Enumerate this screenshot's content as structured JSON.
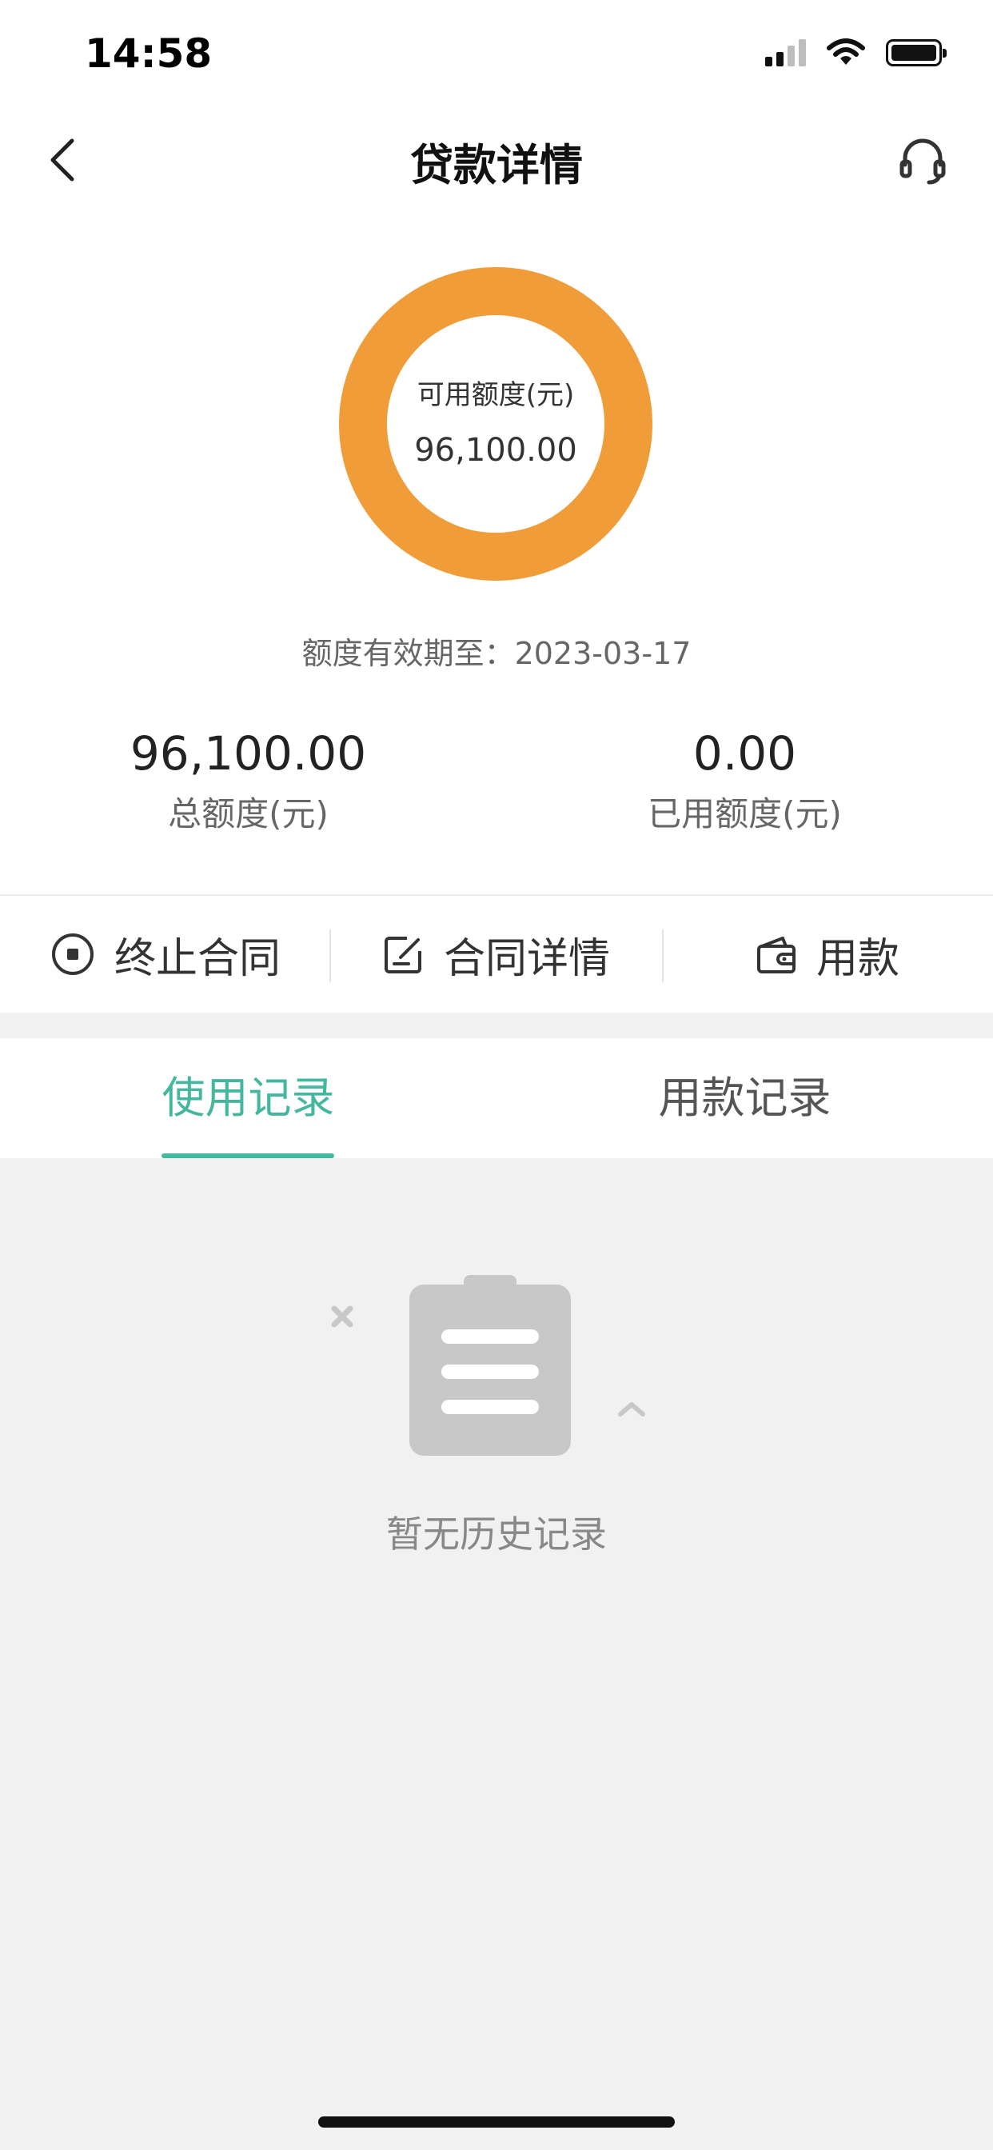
{
  "status_bar": {
    "time": "14:58"
  },
  "nav": {
    "title": "贷款详情"
  },
  "credit": {
    "available_label": "可用额度(元)",
    "available_value": "96,100.00",
    "validity_label": "额度有效期至：",
    "validity_date": "2023-03-17",
    "total_value": "96,100.00",
    "total_label": "总额度(元)",
    "used_value": "0.00",
    "used_label": "已用额度(元)"
  },
  "actions": {
    "terminate": "终止合同",
    "details": "合同详情",
    "use_funds": "用款"
  },
  "tabs": [
    {
      "label": "使用记录",
      "active": true
    },
    {
      "label": "用款记录",
      "active": false
    }
  ],
  "empty": {
    "message": "暂无历史记录"
  },
  "colors": {
    "ring": "#f09c38",
    "accent": "#45b79f",
    "empty_icon": "#c8c8c8"
  },
  "icons": {
    "back": "chevron-left-icon",
    "customer_service": "headset-icon",
    "terminate": "stop-circle-icon",
    "details": "edit-document-icon",
    "use_funds": "wallet-icon",
    "empty": "clipboard-icon"
  }
}
